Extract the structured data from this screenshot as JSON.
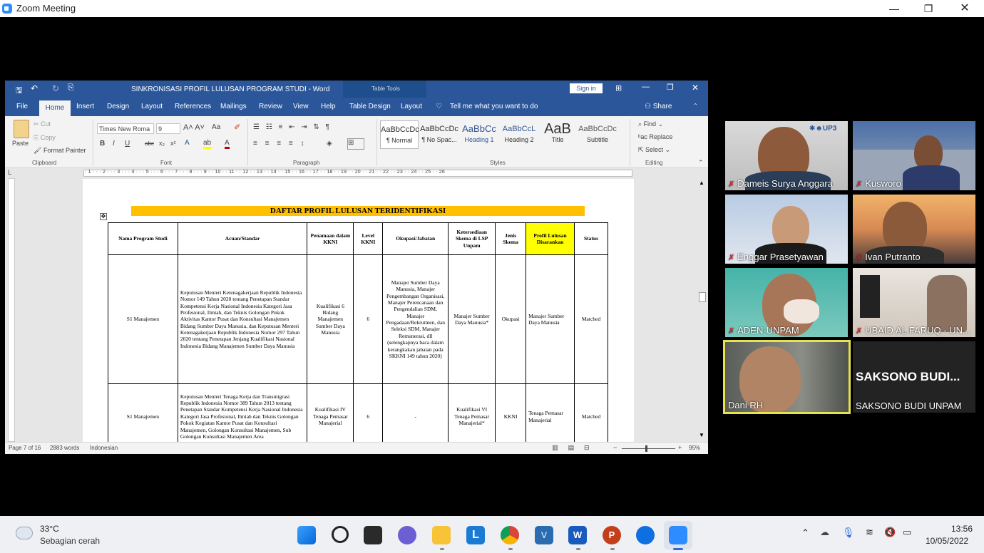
{
  "zoom": {
    "title": "Zoom Meeting"
  },
  "word": {
    "title": "SINKRONISASI PROFIL LULUSAN PROGRAM STUDI  -  Word",
    "context_tab": "Table Tools",
    "sign_in": "Sign in",
    "tabs": [
      "File",
      "Home",
      "Insert",
      "Design",
      "Layout",
      "References",
      "Mailings",
      "Review",
      "View",
      "Help",
      "Table Design",
      "Layout"
    ],
    "tell_me": "Tell me what you want to do",
    "share": "Share",
    "clipboard": {
      "paste": "Paste",
      "cut": "Cut",
      "copy": "Copy",
      "format_painter": "Format Painter",
      "label": "Clipboard"
    },
    "font": {
      "name": "Times New Roma",
      "size": "9",
      "label": "Font"
    },
    "paragraph_label": "Paragraph",
    "styles": {
      "label": "Styles",
      "items": [
        {
          "sample": "AaBbCcDc",
          "name": "¶ Normal"
        },
        {
          "sample": "AaBbCcDc",
          "name": "¶ No Spac..."
        },
        {
          "sample": "AaBbCc",
          "name": "Heading 1"
        },
        {
          "sample": "AaBbCcL",
          "name": "Heading 2"
        },
        {
          "sample": "AaB",
          "name": "Title"
        },
        {
          "sample": "AaBbCcDc",
          "name": "Subtitle"
        }
      ]
    },
    "editing": {
      "find": "Find",
      "replace": "Replace",
      "select": "Select",
      "label": "Editing"
    },
    "ruler": "· 1 · · · 2 · · · 3 · · · 4 · · · 5 · · · 6 · · · 7 · · · 8 · · · 9 · · 10 · · 11 · · 12 · · 13 · · 14 · · 15 · · 16 · · 17 · · 18 · · 19 · · 20 · · 21 · · 22 · · 23 · · 24 · · 25 · · 26",
    "status": {
      "page": "Page 7 of 16",
      "words": "2883 words",
      "lang": "Indonesian",
      "zoom": "95%"
    }
  },
  "doc": {
    "title": "DAFTAR PROFIL LULUSAN TERIDENTIFIKASI",
    "headers": [
      "Nama Program Studi",
      "Acuan/Standar",
      "Penamaan dalam KKNI",
      "Level KKNI",
      "Okupasi/Jabatan",
      "Ketersediaan Skema di LSP Unpam",
      "Jenis Skema",
      "Profil Lulusan Disarankan",
      "Status"
    ],
    "rows": [
      [
        "S1 Manajemen",
        "Keputusan Menteri Ketenagakerjaan Republik Indonesia Nomor 149 Tahun 2020 tentang Penetapan Standar Kompetensi Kerja Nasional Indonesia Kategori Jasa Profesional, Ilmiah, dan Teknis Golongan Pokok Aktivitas Kantor Pusat dan Konsultasi Manajemen Bidang Sumber Daya Manusia, dan Keputusan Menteri Ketenagakerjaan Republik Indonesia Nomor 297 Tahun 2020 tentang Penetapan Jenjang Kualifikasi Nasional Indonesia Bidang Manajemen Sumber Daya Manusia",
        "Kualifikasi 6 Bidang Manajemen Sumber Daya Manusia",
        "6",
        "Manajer Sumber Daya Manusia, Manajer Pengembangan Organisasi, Manajer Perencanaan dan Pengendalian SDM, Manajer Pengadaan/Rekrutmen, dan Seleksi SDM, Manajer Remunerasi, dll (selengkapnya baca dalam kerangkakan jabatan pada SKKNI 149 tahun 2020)",
        "Manajer Sumber Daya Manusia*",
        "Okupasi",
        "Manajer Sumber Daya Manusia",
        "Matched"
      ],
      [
        "S1 Manajemen",
        "Keputusan Menteri Tenaga Kerja dan Transmigrasi Republik Indonesia Nomor 389 Tahun 2013 tentang Penetapan Standar Kompetensi Kerja Nasional Indonesia Kategori Jasa Profesional, Ilmiah dan Teknis Golongan Pokok Kegiatan Kantor Pusat dan Konsultasi Manajemen, Golongan Konsultasi Manajemen, Sub Golongan Konsultasi Manajemen Area",
        "Kualifikasi IV Tenaga Pemasar Manajerial",
        "6",
        "-",
        "Kualifikasi VI Tenaga Pemasar Manajerial*",
        "KKNI",
        "Tenaga Pemasar Manajerial",
        "Matched"
      ]
    ]
  },
  "participants": [
    "Dameis Surya Anggara",
    "Kusworo",
    "Enggar Prasetyawan",
    "Ivan Putranto",
    "ADEN-UNPAM",
    "UBAID AL FARUQ - UN...",
    "Dani RH",
    "SAKSONO BUDI UNPAM"
  ],
  "saksono_big": "SAKSONO  BUDI...",
  "weather": {
    "temp": "33°C",
    "desc": "Sebagian cerah"
  },
  "clock": {
    "time": "13:56",
    "date": "10/05/2022"
  }
}
